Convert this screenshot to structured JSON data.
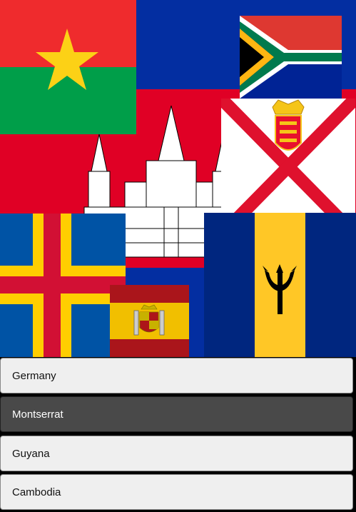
{
  "quiz": {
    "flags": [
      {
        "name": "Cambodia"
      },
      {
        "name": "Burkina Faso"
      },
      {
        "name": "South Africa"
      },
      {
        "name": "Jersey"
      },
      {
        "name": "Åland Islands"
      },
      {
        "name": "Barbados"
      },
      {
        "name": "Spain"
      }
    ],
    "options": [
      {
        "label": "Germany",
        "selected": false
      },
      {
        "label": "Montserrat",
        "selected": true
      },
      {
        "label": "Guyana",
        "selected": false
      },
      {
        "label": "Cambodia",
        "selected": false
      }
    ]
  },
  "colors": {
    "option_bg": "#efefef",
    "option_selected_bg": "#494949"
  }
}
